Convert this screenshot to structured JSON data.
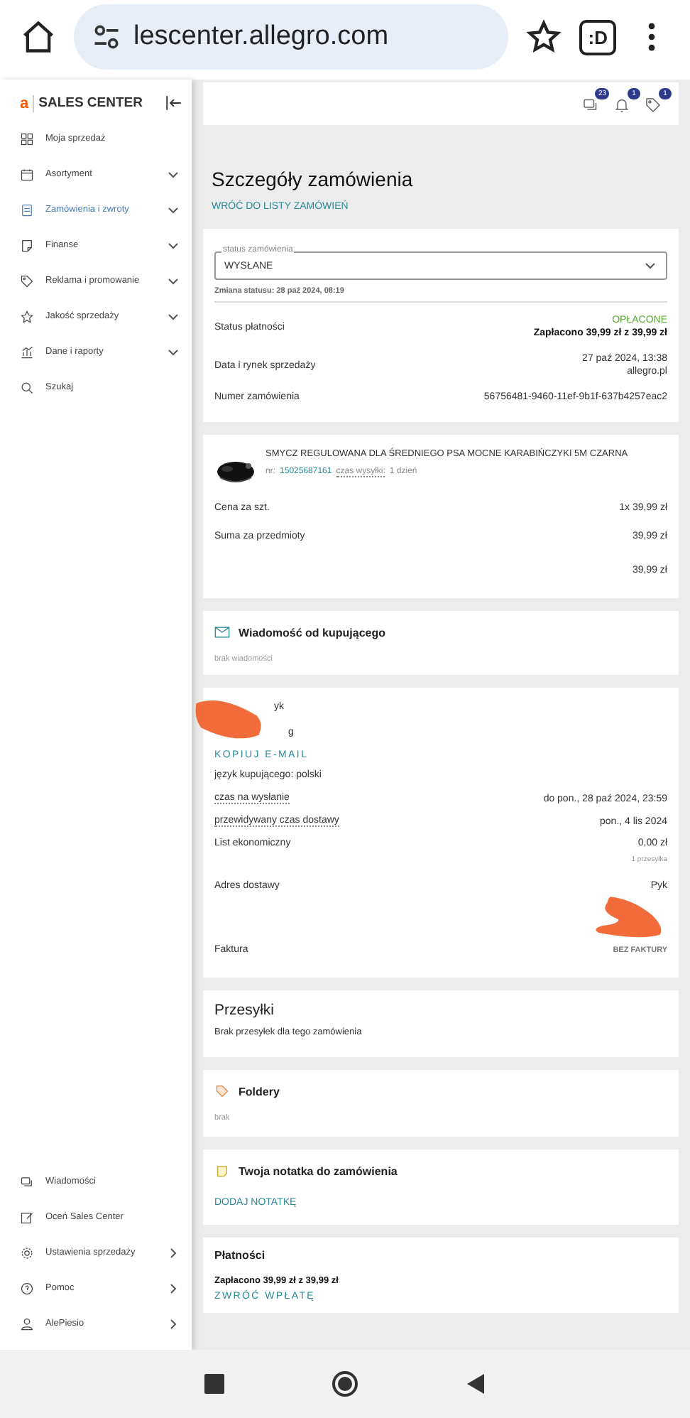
{
  "browser": {
    "url": "lescenter.allegro.com",
    "tab_label": ":D"
  },
  "sidebar": {
    "logo_mark": "a",
    "logo_text": "SALES CENTER",
    "items": [
      {
        "label": "Moja sprzedaż",
        "kind": "plain",
        "selected": false
      },
      {
        "label": "Asortyment",
        "kind": "collapsible",
        "selected": false
      },
      {
        "label": "Zamówienia i zwroty",
        "kind": "collapsible",
        "selected": true
      },
      {
        "label": "Finanse",
        "kind": "collapsible",
        "selected": false
      },
      {
        "label": "Reklama i promowanie",
        "kind": "collapsible",
        "selected": false
      },
      {
        "label": "Jakość sprzedaży",
        "kind": "collapsible",
        "selected": false
      },
      {
        "label": "Dane i raporty",
        "kind": "collapsible",
        "selected": false
      },
      {
        "label": "Szukaj",
        "kind": "plain",
        "selected": false
      }
    ],
    "bottom_items": [
      {
        "label": "Wiadomości",
        "kind": "plain",
        "selected": false
      },
      {
        "label": "Oceń Sales Center",
        "kind": "plain",
        "selected": false
      },
      {
        "label": "Ustawienia sprzedaży",
        "kind": "submenu",
        "selected": false
      },
      {
        "label": "Pomoc",
        "kind": "submenu",
        "selected": false
      },
      {
        "label": "AlePiesio",
        "kind": "submenu",
        "selected": false
      }
    ]
  },
  "header": {
    "badges": [
      {
        "count": "23"
      },
      {
        "count": "1"
      },
      {
        "count": "1"
      }
    ]
  },
  "page": {
    "title": "Szczegóły zamówienia",
    "back_link": "WRÓĆ DO LISTY ZAMÓWIEŃ"
  },
  "order": {
    "status_label": "status zamówienia",
    "status_value": "WYSŁANE",
    "status_change": "Zmiana statusu: 28 paź 2024, 08:19",
    "rows": [
      {
        "label": "Status płatności",
        "values": [
          {
            "kind": "status",
            "text": "OPŁACONE"
          },
          {
            "kind": "bold",
            "text": "Zapłacono 39,99 zł z 39,99 zł"
          }
        ]
      },
      {
        "label": "Data i rynek sprzedaży",
        "values": [
          {
            "kind": "plain",
            "text": "27 paź 2024, 13:38"
          },
          {
            "kind": "plain",
            "text": "allegro.pl"
          }
        ]
      },
      {
        "label": "Numer zamówienia",
        "values": [
          {
            "kind": "plain",
            "text": "56756481-9460-11ef-9b1f-637b4257eac2"
          }
        ]
      }
    ]
  },
  "product": {
    "title": "SMYCZ REGULOWANA DLA ŚREDNIEGO PSA MOCNE KARABIŃCZYKI 5M CZARNA",
    "nr_label": "nr:",
    "nr": "15025687161",
    "shipping_label": "czas wysyłki:",
    "shipping": "1 dzień",
    "rows": [
      {
        "label": "Cena za szt.",
        "value": "1x 39,99 zł"
      },
      {
        "label": "Suma za przedmioty",
        "value": "39,99 zł"
      }
    ],
    "total": "39,99 zł"
  },
  "message": {
    "title": "Wiadomość od kupującego",
    "text": "brak wiadomości"
  },
  "buyer": {
    "fragments": [
      "yk",
      "g"
    ],
    "copy_email": "KOPIUJ E-MAIL",
    "language": "język kupującego: polski",
    "rows": [
      {
        "label": "czas na wysłanie",
        "underlined": true,
        "value": "do pon., 28 paź 2024, 23:59",
        "note": null
      },
      {
        "label": "przewidywany czas dostawy",
        "underlined": true,
        "value": "pon., 4 lis 2024",
        "note": null
      },
      {
        "label": "List ekonomiczny",
        "underlined": false,
        "value": "0,00 zł",
        "note": "1 przesyłka"
      }
    ],
    "address_label": "Adres dostawy",
    "address_fragment": "Pyk",
    "invoice_label": "Faktura",
    "invoice_value": "BEZ FAKTURY"
  },
  "shipments": {
    "title": "Przesyłki",
    "text": "Brak przesyłek dla tego zamówienia"
  },
  "folders": {
    "title": "Foldery",
    "text": "brak"
  },
  "note": {
    "title": "Twoja notatka do zamówienia",
    "action": "DODAJ NOTATKĘ"
  },
  "payments": {
    "title": "Płatności",
    "paid": "Zapłacono 39,99 zł z 39,99 zł",
    "action": "ZWRÓĆ WPŁATĘ"
  }
}
